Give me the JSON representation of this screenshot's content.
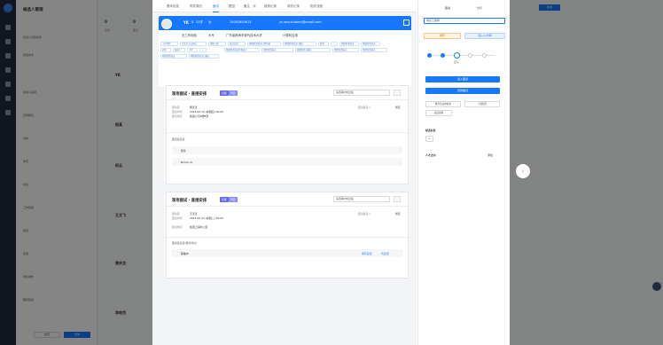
{
  "app": {
    "title": "候选人管理",
    "new_button": "新增",
    "filter_title": "候选人搜索",
    "filter_sub": "候选人筛选条件"
  },
  "filters": [
    "筛选条件",
    "候选人来源",
    "应聘职位",
    "年龄",
    "学历",
    "标签",
    "工作经验",
    "性别",
    "来源",
    "所在城市",
    "期望薪资"
  ],
  "filter_footer": {
    "reset": "重置",
    "search": "查询"
  },
  "main": {
    "stats": [
      "0",
      "0",
      "0",
      "0"
    ],
    "stat_labels": [
      "初筛",
      "面试",
      "沟通",
      "入职"
    ],
    "bg_names": [
      "YK",
      "杨某",
      "阿云",
      "王文飞",
      "曾庆龙",
      "李屹然"
    ]
  },
  "modal": {
    "tabs": [
      "基本信息",
      "附件简历",
      "面试",
      "跟进",
      "备注",
      "推荐记录",
      "操作记录",
      "相关流程"
    ],
    "active_tab": "面试",
    "note_count": "0",
    "profile": {
      "name": "YK",
      "gender_icon": "♀",
      "age": "女",
      "source": "33岁",
      "phone": "15051654613",
      "email": "yk.dev.student@email.com",
      "edu": "无工作经验",
      "degree": "大专",
      "school": "广东省珠海市现代技术大学",
      "expected": "计算机应用",
      "tags": [
        "工作经验",
        "毕业生对口职位",
        "期望入职",
        "面试交流",
        "期望薪资面议已经沟通",
        "期望薪资面议已确认",
        "其他",
        "...",
        "期望薪资面议",
        "期望薪资面议",
        "其他",
        "候选人",
        "小学",
        "...",
        "期望薪资面议的候选人",
        "期望薪资面议",
        "期望薪资已确认",
        "期望薪资面议",
        "期望薪资面议",
        "期望薪资面议",
        "期望薪资面议已确认"
      ]
    },
    "interviews": [
      {
        "title": "现场面试 · 直接安排",
        "badge": "初面",
        "badge2": "待定",
        "select": "请选择(未反馈)",
        "fields": [
          {
            "k": "面试时间",
            "v": "2024-06-20 (星期四) 09:00"
          },
          {
            "k": "面试官",
            "v": "杨某某"
          },
          {
            "k": "面试地点",
            "v": "集团公司4楼B室"
          },
          {
            "k": "面试联系人",
            "v": "张某"
          }
        ],
        "section": "面试官反馈",
        "rows": [
          "张某",
          "Nicole Vo"
        ]
      },
      {
        "title": "现场面试 · 直接安排",
        "badge": "复面",
        "badge2": "待定",
        "select": "请选择(未反馈)",
        "fields": [
          {
            "k": "面试时间",
            "v": "2024-06-04 (星期二) 09:00"
          },
          {
            "k": "面试官",
            "v": "王某某"
          },
          {
            "k": "面试地点",
            "v": "集团上海办公室"
          },
          {
            "k": "面试联系人",
            "v": "张某"
          }
        ],
        "section": "面试官反馈(部分评价)",
        "rows": [
          "陈敏JB"
        ],
        "links": [
          "填写反馈",
          "代反馈"
        ]
      }
    ],
    "right": {
      "top_tabs": [
        "跟进",
        "分享"
      ],
      "position": "购买工程师",
      "btn_invite": "推荐",
      "btn_blacklist": "加入人才库",
      "steps": [
        "初筛",
        "面试",
        "沟通",
        "录用",
        "入职"
      ],
      "step_label": "面试",
      "action1": "进入面试",
      "action2": "安排面试",
      "action3": "推荐给其他职位",
      "action4": "下载简历",
      "action5": "发送提醒",
      "tag_title": "候选标签",
      "add_tag": "+",
      "talent_title": "人才去向",
      "talent_add": "添加"
    }
  },
  "colors": {
    "primary": "#1677ff",
    "badge": "#6366f1",
    "sidebar": "#1f2a3d"
  }
}
